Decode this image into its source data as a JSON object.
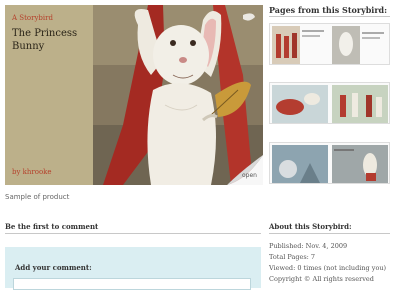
{
  "book": {
    "tag": "A Storybird",
    "title": "The Princess Bunny",
    "byline": "by khrooke",
    "open_label": "open",
    "sample_caption": "Sample of product"
  },
  "pages_panel": {
    "title": "Pages from this Storybird:",
    "thumbnails": [
      "page-spread-1",
      "page-spread-2",
      "page-spread-3"
    ]
  },
  "comments": {
    "heading": "Be the first to comment",
    "add_label": "Add your comment:"
  },
  "about": {
    "heading": "About this Storybird:",
    "published": "Published: Nov. 4, 2009",
    "total_pages": "Total Pages: 7",
    "viewed": "Viewed: 0 times (not including you)",
    "copyright": "Copyright © All rights reserved"
  },
  "colors": {
    "cover": "#bcb08a",
    "accent_red": "#b5402b",
    "comment_box": "#daeef2"
  }
}
